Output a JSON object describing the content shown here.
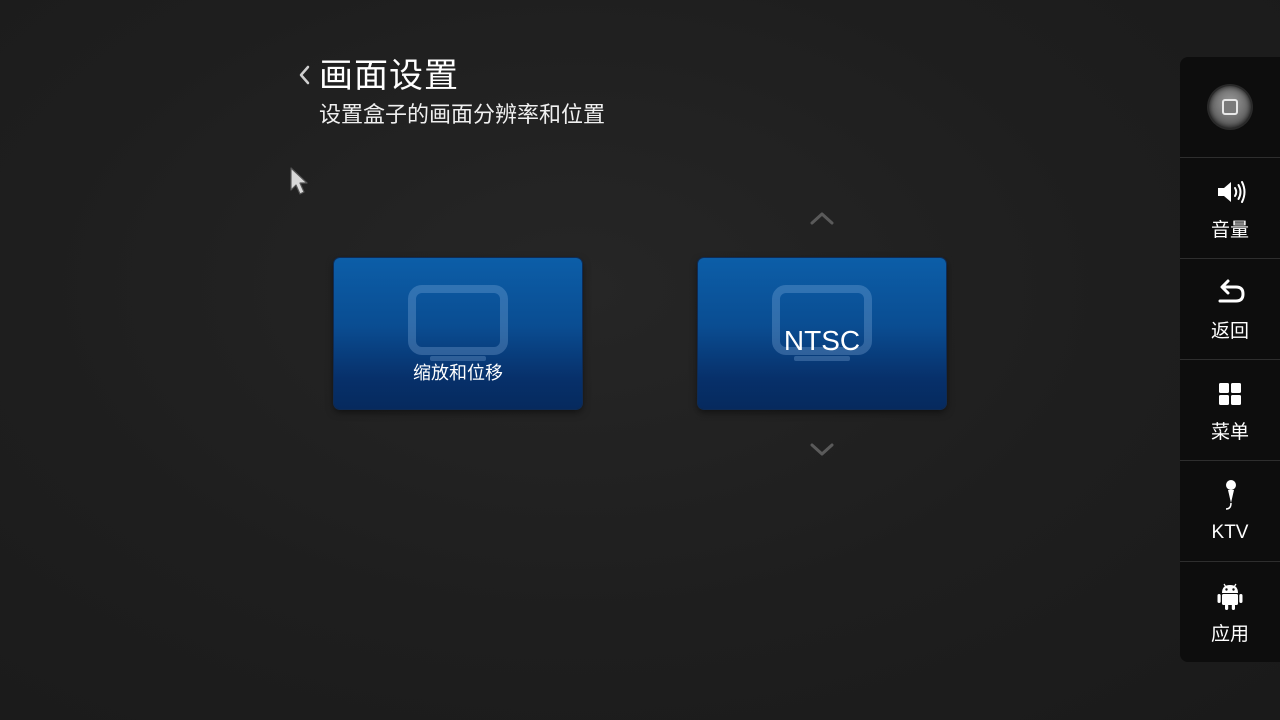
{
  "header": {
    "title": "画面设置",
    "subtitle": "设置盒子的画面分辨率和位置"
  },
  "tiles": [
    {
      "label": "缩放和位移",
      "icon": "monitor-icon"
    },
    {
      "value": "NTSC",
      "icon": "monitor-icon"
    }
  ],
  "side_panel": {
    "home_icon": "home-button-icon",
    "items": [
      {
        "label": "音量",
        "icon": "volume-icon"
      },
      {
        "label": "返回",
        "icon": "back-arrow-icon"
      },
      {
        "label": "菜单",
        "icon": "grid-menu-icon"
      },
      {
        "label": "KTV",
        "icon": "microphone-icon"
      },
      {
        "label": "应用",
        "icon": "android-icon"
      }
    ]
  },
  "colors": {
    "background": "#1e1e1e",
    "tile_top": "#0c5ea8",
    "tile_bottom": "#062a5e",
    "side_panel": "#0d0d0d"
  }
}
